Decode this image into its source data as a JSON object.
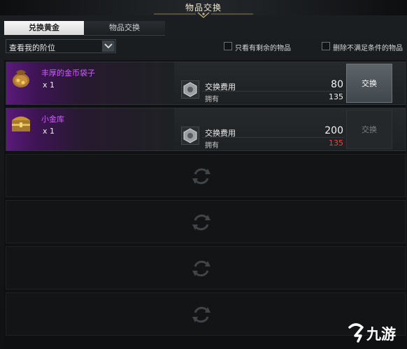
{
  "window": {
    "title": "物品交换"
  },
  "tabs": [
    {
      "label": "兑换黄金",
      "active": true
    },
    {
      "label": "物品交换",
      "active": false
    }
  ],
  "filters": {
    "rank_select": {
      "value": "查看我的阶位"
    },
    "checkbox_remaining": {
      "label": "只看有剩余的物品",
      "checked": false
    },
    "checkbox_remove_unmet": {
      "label": "删除不满足条件的物品",
      "checked": false
    }
  },
  "rows": [
    {
      "name": "丰厚的金币袋子",
      "qty": "x 1",
      "icon": "coin-pouch-icon",
      "cost_label": "交换费用",
      "cost_value": "80",
      "own_label": "拥有",
      "own_value": "135",
      "button_label": "交换",
      "enabled": true
    },
    {
      "name": "小金库",
      "qty": "x 1",
      "icon": "treasure-chest-icon",
      "cost_label": "交换费用",
      "cost_value": "200",
      "own_label": "拥有",
      "own_value": "135",
      "button_label": "交换",
      "enabled": false
    }
  ],
  "empty_slots": 4,
  "watermark": {
    "text": "九游"
  },
  "colors": {
    "item_name": "#d05cff",
    "insufficient": "#ff3b3b",
    "accent_purple": "#5a1a7a"
  }
}
